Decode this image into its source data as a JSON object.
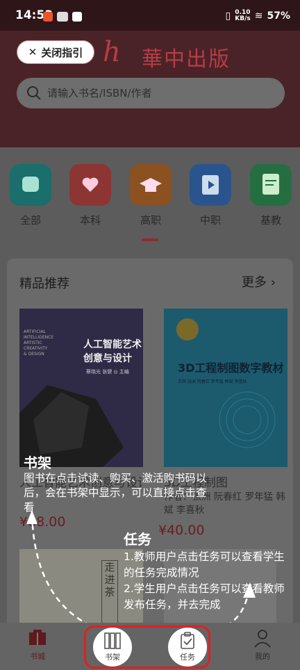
{
  "status_bar": {
    "time": "14:53",
    "network_speed": "0.10\nKB/s",
    "battery": "57%"
  },
  "header": {
    "close_guide_label": "关闭指引",
    "logo_text": "華中出版",
    "logo_mark": "h"
  },
  "search": {
    "placeholder": "请输入书名/ISBN/作者"
  },
  "categories": [
    {
      "label": "全部",
      "color": "#1aa5a0"
    },
    {
      "label": "本科",
      "color": "#d9534f"
    },
    {
      "label": "高职",
      "color": "#e07a2c"
    },
    {
      "label": "中职",
      "color": "#3b82d9"
    },
    {
      "label": "基教",
      "color": "#37a864"
    }
  ],
  "featured": {
    "title": "精品推荐",
    "more_label": "更多"
  },
  "books": [
    {
      "cover_title": "人工智能艺术\n创意与设计",
      "cover_en": "ARTIFICIAL\nINTELLIGENCE\nARTISTIC\nCREATIVITY\n& DESIGN",
      "cover_authors": "蔡晓光 张健 ◎ 主编",
      "title_visible": "人工智能艺术创意与设计",
      "author_visible": "",
      "price": "¥88.00"
    },
    {
      "cover_title": "3D工程制图数字教材",
      "cover_authors": "王辉 张洲 阮春红 罗年猛 韩斌 李喜秋",
      "title_visible": "3D工程制图",
      "author_visible": "作者：张洲 阮春红 罗年猛 韩斌 李喜秋",
      "price": "¥40.00"
    }
  ],
  "guide": {
    "shelf_title": "书架",
    "shelf_desc": "图书在点击试读、购买、激活购书码以后，会在书架中显示，可以直接点击查看",
    "task_title": "任务",
    "task_desc_1": "1.教师用户点击任务可以查看学生的任务完成情况",
    "task_desc_2": "2.学生用户点击任务可以查看教师发布任务，并去完成"
  },
  "tabbar": {
    "home": "书城",
    "shelf": "书架",
    "task": "任务",
    "mine": "我的"
  }
}
